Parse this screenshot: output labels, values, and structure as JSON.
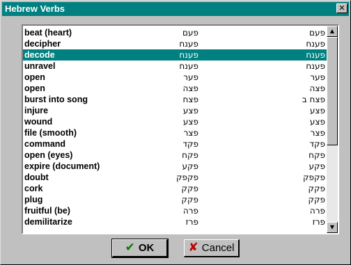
{
  "window": {
    "title": "Hebrew Verbs",
    "close_symbol": "✕"
  },
  "colors": {
    "titlebar": "#008080",
    "selection": "#008080",
    "ok_icon": "#008000",
    "cancel_icon": "#c00000"
  },
  "list": {
    "selected_index": 2,
    "rows": [
      {
        "english": "beat (heart)",
        "root": "פעם",
        "form": "פעם"
      },
      {
        "english": "decipher",
        "root": "פענח",
        "form": "פענח"
      },
      {
        "english": "decode",
        "root": "פענח",
        "form": "פענח"
      },
      {
        "english": "unravel",
        "root": "פענח",
        "form": "פענח"
      },
      {
        "english": "open",
        "root": "פער",
        "form": "פער"
      },
      {
        "english": "open",
        "root": "פצה",
        "form": "פצה"
      },
      {
        "english": "burst into song",
        "root": "פצח",
        "form": "פצח ב"
      },
      {
        "english": "injure",
        "root": "פצע",
        "form": "פצע"
      },
      {
        "english": "wound",
        "root": "פצע",
        "form": "פצע"
      },
      {
        "english": "file (smooth)",
        "root": "פצר",
        "form": "פצר"
      },
      {
        "english": "command",
        "root": "פקד",
        "form": "פקד"
      },
      {
        "english": "open (eyes)",
        "root": "פקח",
        "form": "פקח"
      },
      {
        "english": "expire (document)",
        "root": "פקע",
        "form": "פקע"
      },
      {
        "english": "doubt",
        "root": "פקפק",
        "form": "פקפק"
      },
      {
        "english": "cork",
        "root": "פקק",
        "form": "פקק"
      },
      {
        "english": "plug",
        "root": "פקק",
        "form": "פקק"
      },
      {
        "english": "fruitful (be)",
        "root": "פרה",
        "form": "פרה"
      },
      {
        "english": "demilitarize",
        "root": "פרז",
        "form": "פרז"
      }
    ]
  },
  "scrollbar": {
    "up_symbol": "▲",
    "down_symbol": "▼"
  },
  "buttons": {
    "ok": {
      "label": "OK",
      "icon": "check-icon",
      "symbol": "✔"
    },
    "cancel": {
      "label": "Cancel",
      "icon": "x-icon",
      "symbol": "✘"
    }
  }
}
